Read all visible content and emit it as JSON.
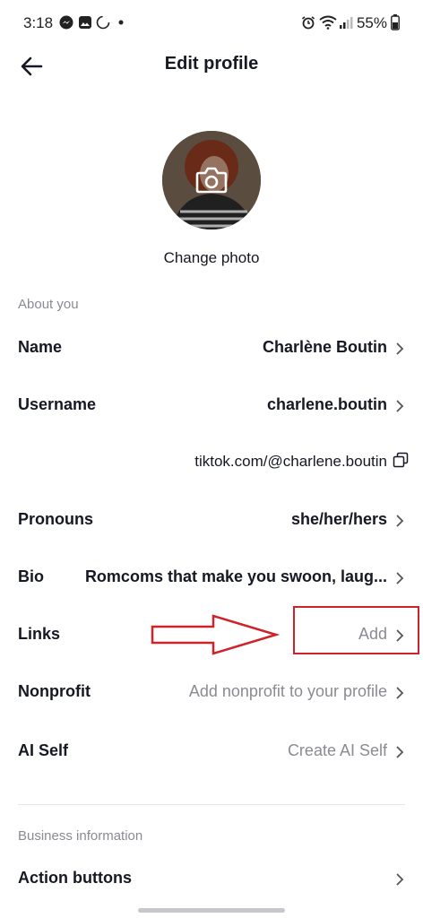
{
  "status_bar": {
    "time": "3:18",
    "battery": "55%"
  },
  "header": {
    "title": "Edit profile"
  },
  "photo": {
    "change_label": "Change photo"
  },
  "about": {
    "section_label": "About you",
    "rows": [
      {
        "label": "Name",
        "value": "Charlène Boutin"
      },
      {
        "label": "Username",
        "value": "charlene.boutin"
      },
      {
        "label": "Pronouns",
        "value": "she/her/hers"
      },
      {
        "label": "Bio",
        "value": "Romcoms that make you swoon, laug..."
      },
      {
        "label": "Links",
        "value": "Add"
      },
      {
        "label": "Nonprofit",
        "value": "Add nonprofit to your profile"
      },
      {
        "label": "AI Self",
        "value": "Create AI Self"
      }
    ],
    "profile_link": "tiktok.com/@charlene.boutin"
  },
  "business": {
    "section_label": "Business information",
    "rows": [
      {
        "label": "Action buttons",
        "value": ""
      }
    ]
  },
  "colors": {
    "accent_annotation": "#d0222a",
    "muted": "#8a8b91",
    "text": "#161823"
  }
}
